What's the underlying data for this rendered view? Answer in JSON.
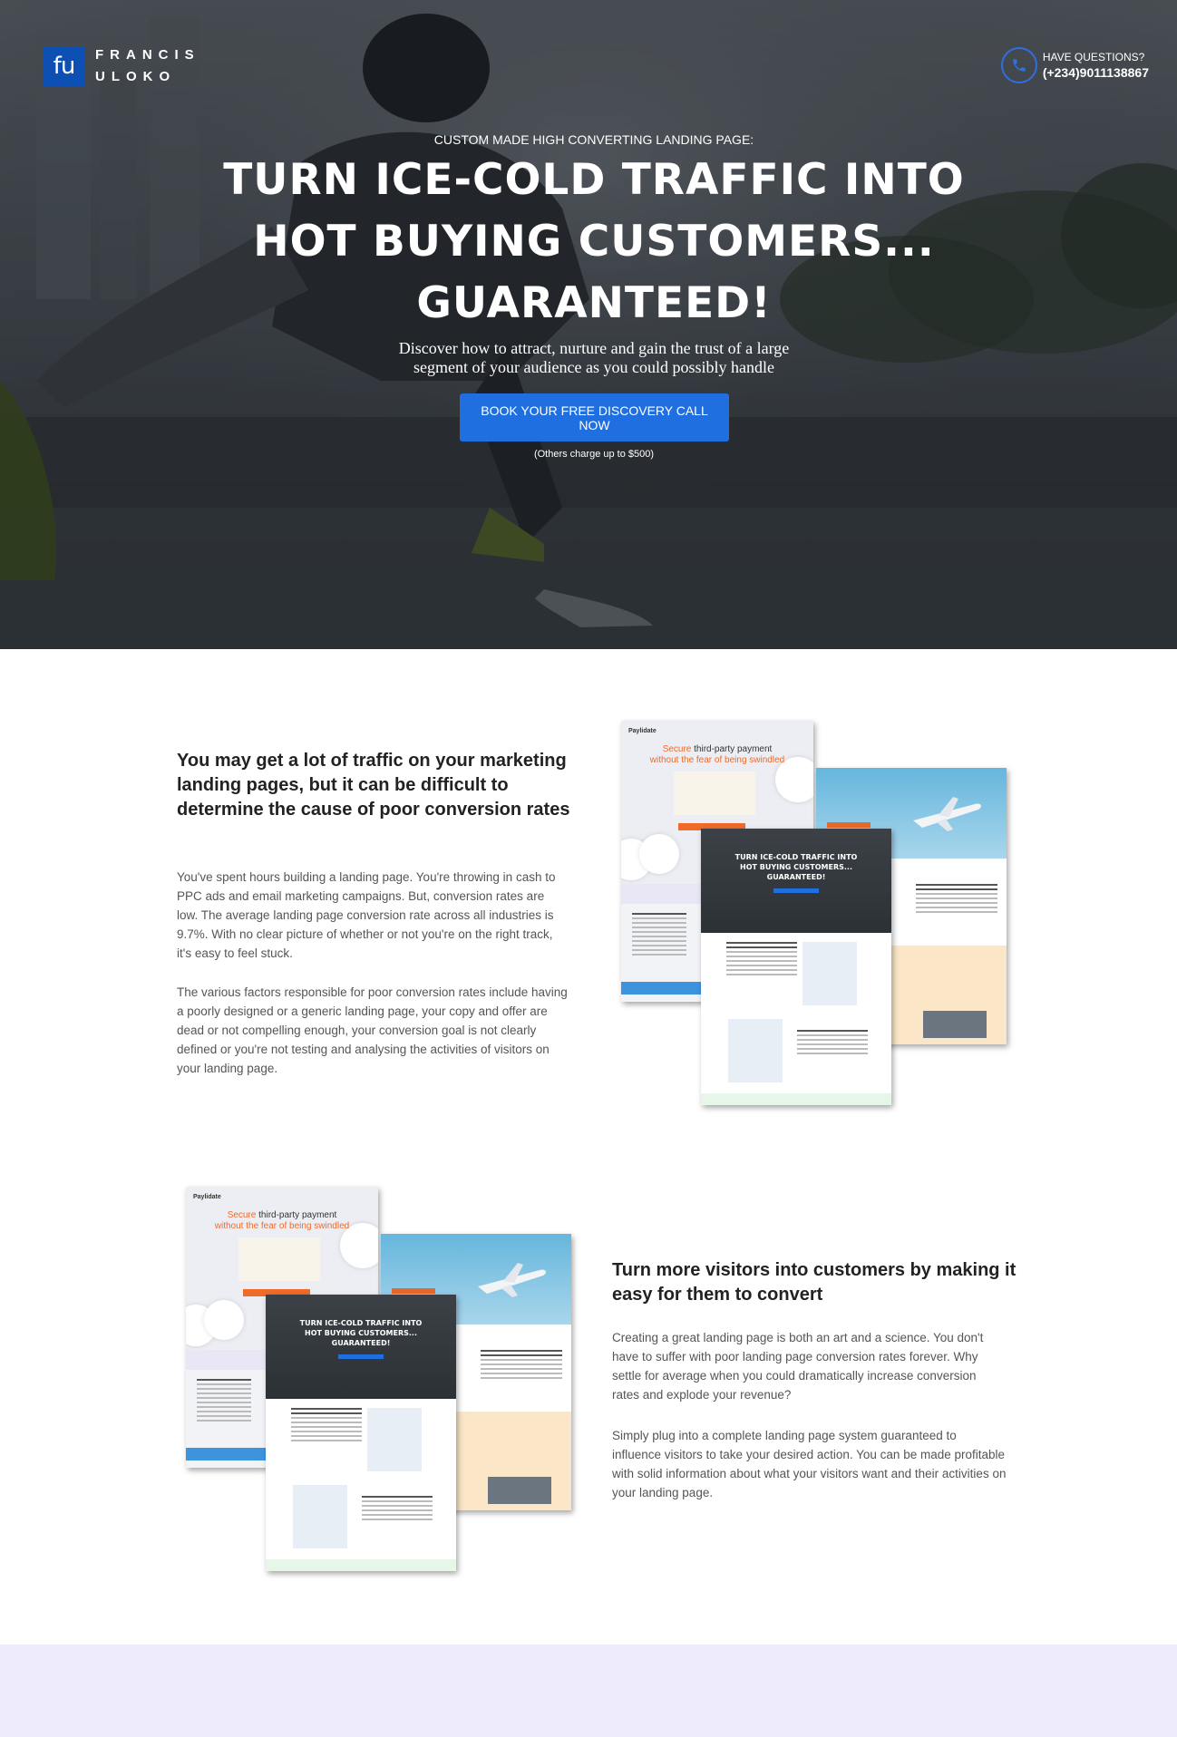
{
  "brand": {
    "logo_mark": "fu",
    "name_line1": "FRANCIS",
    "name_line2": "ULOKO"
  },
  "contact": {
    "icon": "phone-icon",
    "label": "HAVE QUESTIONS?",
    "phone": "(+234)9011138867",
    "accent_color": "#2f6fe0"
  },
  "hero": {
    "eyebrow": "CUSTOM MADE HIGH CONVERTING LANDING PAGE:",
    "headline_lines": [
      "TURN ICE-COLD TRAFFIC INTO",
      "HOT BUYING CUSTOMERS...",
      "GUARANTEED!"
    ],
    "subhead_lines": [
      "Discover how to attract, nurture and gain the trust of a large",
      "segment of your audience as you could possibly handle"
    ],
    "cta_label": "BOOK YOUR FREE DISCOVERY CALL NOW",
    "cta_color": "#1f6fe0",
    "cta_note": "(Others charge up to $500)"
  },
  "section1": {
    "title": "You may get a lot of traffic on your marketing landing pages, but it can be difficult to determine the cause of poor conversion rates",
    "paragraph1": "You've spent hours building a landing page. You're throwing in cash to PPC ads and email marketing campaigns. But, conversion rates are low. The average landing page conversion rate across all industries is 9.7%. With no clear picture of whether or not you're on the right track, it's easy to feel stuck.",
    "paragraph2": "The various factors responsible for poor conversion rates include having a poorly designed or a generic landing page, your copy and offer are dead or not compelling enough, your conversion goal is not clearly defined or you're not testing and analysing the activities of visitors on your landing page."
  },
  "section2": {
    "title": "Turn more visitors into customers by making it easy for them to convert",
    "paragraph1": "Creating a great landing page is both an art and a science. You don't have to suffer with poor landing page conversion rates forever. Why settle for average when you could dramatically increase conversion rates and explode your revenue?",
    "paragraph2": "Simply plug into a complete landing page system guaranteed to influence visitors to take your desired action. You can be made profitable with solid information about what your visitors want and their activities on your landing page."
  },
  "mockup": {
    "brand": "Paylidate",
    "headline_part1": "Secure",
    "headline_part2": " third-party payment",
    "headline_part3": "without the fear of ",
    "headline_part4": "being swindled",
    "inner_title_lines": [
      "TURN ICE-COLD TRAFFIC INTO",
      "HOT BUYING CUSTOMERS...",
      "GUARANTEED!"
    ],
    "accent_orange": "#f06a2a"
  },
  "colors": {
    "logo_blue": "#0e4fb3",
    "footer_band": "#eeecfc"
  }
}
